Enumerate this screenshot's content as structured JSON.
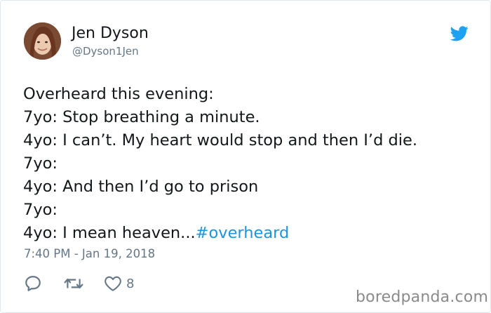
{
  "author": {
    "name": "Jen Dyson",
    "handle": "@Dyson1Jen"
  },
  "tweet": {
    "lines": [
      "Overheard this evening:",
      "7yo: Stop breathing a minute.",
      "4yo: I can’t. My heart would stop and then I’d die.",
      "7yo:",
      "4yo: And then I’d go to prison",
      "7yo:",
      "4yo: I mean heaven..."
    ],
    "hashtag": "#overheard",
    "timestamp": "7:40 PM - Jan 19, 2018"
  },
  "actions": {
    "like_count": "8"
  },
  "watermark": "boredpanda.com",
  "colors": {
    "text": "#14171a",
    "secondary": "#657786",
    "link": "#1b95e0",
    "twitter_blue": "#1da1f2"
  },
  "icons": [
    "avatar-photo",
    "twitter-bird-icon",
    "reply-icon",
    "retweet-icon",
    "heart-icon"
  ]
}
